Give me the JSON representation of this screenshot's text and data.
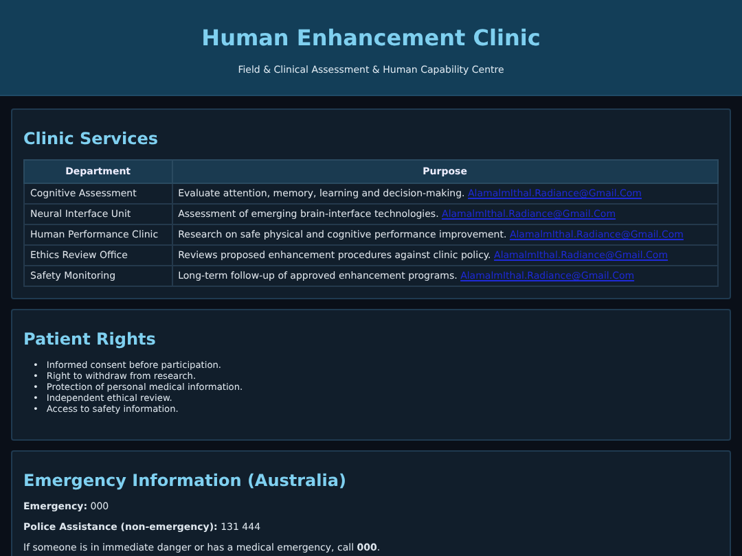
{
  "header": {
    "title": "Human Enhancement Clinic",
    "subtitle": "Field & Clinical Assessment & Human Capability Centre"
  },
  "services": {
    "heading": "Clinic Services",
    "columns": [
      "Department",
      "Purpose"
    ],
    "rows": [
      {
        "department": "Cognitive Assessment",
        "purpose": "Evaluate attention, memory, learning and decision-making.",
        "link": "AlamalmIthal.Radiance@Gmail.Com"
      },
      {
        "department": "Neural Interface Unit",
        "purpose": "Assessment of emerging brain-interface technologies.",
        "link": "AlamalmIthal.Radiance@Gmail.Com"
      },
      {
        "department": "Human Performance Clinic",
        "purpose": "Research on safe physical and cognitive performance improvement.",
        "link": "AlamalmIthal.Radiance@Gmail.Com"
      },
      {
        "department": "Ethics Review Office",
        "purpose": "Reviews proposed enhancement procedures against clinic policy.",
        "link": "AlamalmIthal.Radiance@Gmail.Com"
      },
      {
        "department": "Safety Monitoring",
        "purpose": "Long-term follow-up of approved enhancement programs.",
        "link": "AlamalmIthal.Radiance@Gmail.Com"
      }
    ]
  },
  "rights": {
    "heading": "Patient Rights",
    "bullet": "•",
    "items": [
      "Informed consent before participation.",
      "Right to withdraw from research.",
      "Protection of personal medical information.",
      "Independent ethical review.",
      "Access to safety information."
    ]
  },
  "emergency": {
    "heading": "Emergency Information (Australia)",
    "lines": [
      "**Emergency:** 000",
      "**Police Assistance (non-emergency):** 131 444",
      "If someone is in immediate danger or has a medical emergency, call **000**."
    ]
  }
}
